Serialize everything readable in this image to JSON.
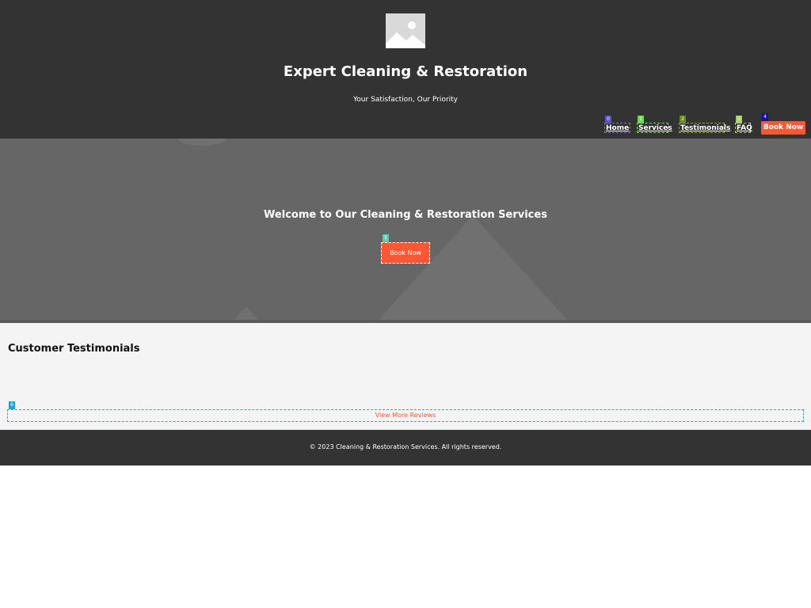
{
  "header": {
    "title": "Expert Cleaning & Restoration",
    "tagline": "Your Satisfaction, Our Priority",
    "logo_icon": "image-placeholder-icon"
  },
  "nav": {
    "items": [
      {
        "label": "Home",
        "badge": "0",
        "badge_color": "#5b4fc4"
      },
      {
        "label": "Services",
        "badge": "1",
        "badge_color": "#66dd44"
      },
      {
        "label": "Testimonials",
        "badge": "2",
        "badge_color": "#6b8a1e"
      },
      {
        "label": "FAQ",
        "badge": "3",
        "badge_color": "#a8d060"
      }
    ],
    "cta": {
      "label": "Book Now",
      "badge": "4",
      "badge_color": "#1a10a0"
    }
  },
  "hero": {
    "title": "Welcome to Our Cleaning & Restoration Services",
    "button_label": "Book Now",
    "button_badge": "5",
    "button_badge_color": "#55ccbb"
  },
  "testimonials": {
    "heading": "Customer Testimonials",
    "more_label": "View More Reviews",
    "more_badge": "6",
    "more_badge_color": "#1aa6dd"
  },
  "footer": {
    "text": "© 2023 Cleaning & Restoration Services. All rights reserved."
  },
  "colors": {
    "accent": "#ff5733",
    "header_bg": "#333333",
    "hero_bg": "#666666",
    "section_bg": "#f4f4f4"
  }
}
